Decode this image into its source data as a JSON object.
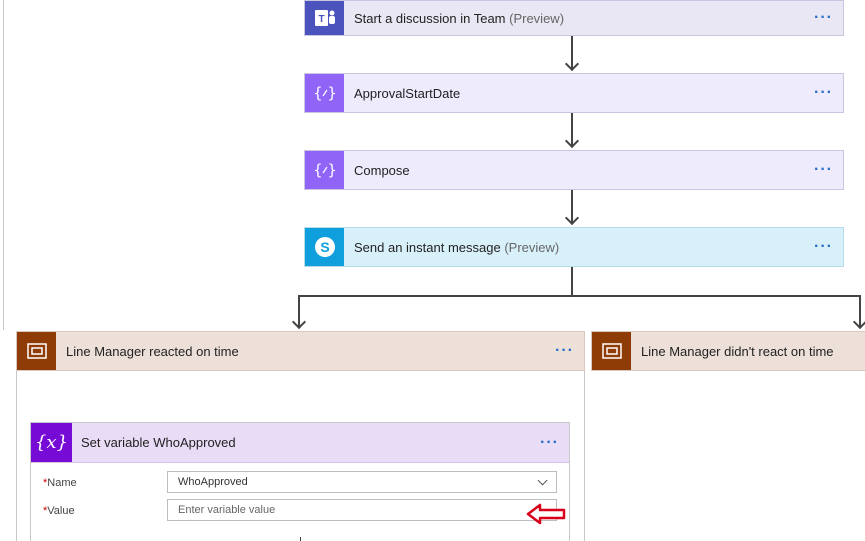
{
  "steps": [
    {
      "title": "Start a discussion in Team",
      "suffix": "(Preview)",
      "icon": "teams-icon"
    },
    {
      "title": "ApprovalStartDate",
      "suffix": "",
      "icon": "compose-icon"
    },
    {
      "title": "Compose",
      "suffix": "",
      "icon": "compose-icon"
    },
    {
      "title": "Send an instant message",
      "suffix": "(Preview)",
      "icon": "skype-icon"
    }
  ],
  "menu_label": "···",
  "branches": {
    "left": {
      "title": "Line Manager reacted on time",
      "icon": "scope-icon"
    },
    "right": {
      "title": "Line Manager didn't react on time",
      "icon": "scope-icon"
    }
  },
  "set_variable": {
    "title": "Set variable WhoApproved",
    "icon_text": "{x}",
    "name_label": "Name",
    "name_value": "WhoApproved",
    "value_label": "Value",
    "value_placeholder": "Enter variable value",
    "required_mark": "*"
  },
  "colors": {
    "teams": "#4b53bc",
    "compose": "#8f64f6",
    "skype": "#0f9fdc",
    "scope": "#8f3b06",
    "variable": "#770bd6",
    "annotation_arrow": "#d9001b"
  }
}
